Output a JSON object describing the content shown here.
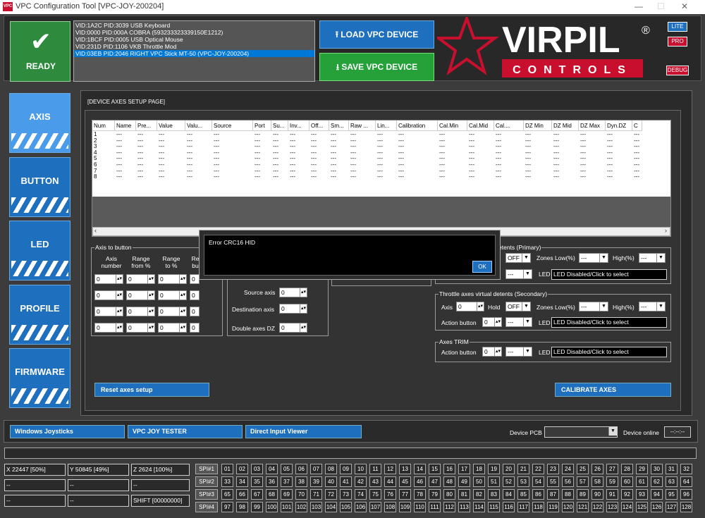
{
  "window": {
    "title": "VPC Configuration Tool [VPC-JOY-200204]",
    "icon_text": "VPC"
  },
  "ready": {
    "label": "READY"
  },
  "devices": [
    "VID:1A2C PID:3039 USB Keyboard",
    "VID:0000 PID:000A COBRA (593233323339150E1212)",
    "VID:1BCF PID:0005 USB Optical Mouse",
    "VID:231D PID:1106 VKB Throttle Mod",
    "VID:03EB PID:2046 RIGHT VPC Stick MT-50 (VPC-JOY-200204)"
  ],
  "selected_device_index": 4,
  "buttons": {
    "load": "LOAD VPC DEVICE",
    "save": "SAVE VPC DEVICE",
    "lite": "LITE",
    "pro": "PRO",
    "debug": "DEBUG"
  },
  "logo": {
    "main": "VIRPIL",
    "sub": "CONTROLS",
    "reg": "®"
  },
  "nav": [
    "AXIS",
    "BUTTON",
    "LED",
    "PROFILE",
    "FIRMWARE"
  ],
  "page_title": "[DEVICE AXES SETUP PAGE]",
  "table": {
    "columns": [
      "Num",
      "Name",
      "Pre...",
      "Value",
      "Valu...",
      "Source",
      "Port",
      "Su...",
      "Inv...",
      "Off...",
      "Sm...",
      "Raw ...",
      "Lin...",
      "Calibration",
      "Cal.Min",
      "Cal.Mid",
      "Cal....",
      "DZ Min",
      "DZ Mid",
      "DZ Max",
      "Dyn.DZ",
      "C"
    ],
    "rows": [
      "1",
      "2",
      "3",
      "4",
      "5",
      "6",
      "7",
      "8"
    ],
    "empty": "---"
  },
  "axis_to_button": {
    "title": "Axis to button",
    "headers": [
      "Axis number",
      "Range from %",
      "Range to %",
      "Re bu"
    ],
    "value": "0"
  },
  "mid_panel": {
    "source_axis": "Source axis",
    "destination_axis": "Destination axis",
    "double_dz": "Double axes DZ",
    "value": "0"
  },
  "primary": {
    "title": "etents (Primary)",
    "hold": "OFF",
    "zones_low": "Zones Low(%)",
    "high": "High(%)",
    "led": "LED",
    "led_value": "LED Disabled/Click to select",
    "dash": "---"
  },
  "secondary": {
    "title": "Throttle axes virtual detents (Secondary)",
    "axis": "Axis",
    "axis_val": "0",
    "hold": "Hold",
    "hold_val": "OFF",
    "zones_low": "Zones Low(%)",
    "high": "High(%)",
    "action": "Action button",
    "action_val": "0",
    "led": "LED",
    "led_value": "LED Disabled/Click to select",
    "dash": "---"
  },
  "trim": {
    "title": "Axes TRIM",
    "action": "Action button",
    "action_val": "0",
    "led": "LED",
    "led_value": "LED Disabled/Click to select",
    "dash": "---"
  },
  "reset_btn": "Reset axes setup",
  "calibrate_btn": "CALIBRATE AXES",
  "dialog": {
    "message": "Error CRC16 HID",
    "ok": "OK"
  },
  "bottom": {
    "win_joy": "Windows Joysticks",
    "tester": "VPC JOY TESTER",
    "diviewer": "Direct Input Viewer",
    "device_pcb": "Device PCB",
    "device_online": "Device online",
    "online_val": "--:--:--"
  },
  "status": {
    "x": "X 22447 [50%]",
    "y": "Y 50845 [49%]",
    "z": "Z 2624 [100%]",
    "r2a": "--",
    "r2b": "--",
    "r2c": "--",
    "r3a": "--",
    "r3b": "--",
    "shift": "SHIFT [00000000]"
  },
  "spi": [
    "SPI#1",
    "SPI#2",
    "SPI#3",
    "SPI#4"
  ]
}
